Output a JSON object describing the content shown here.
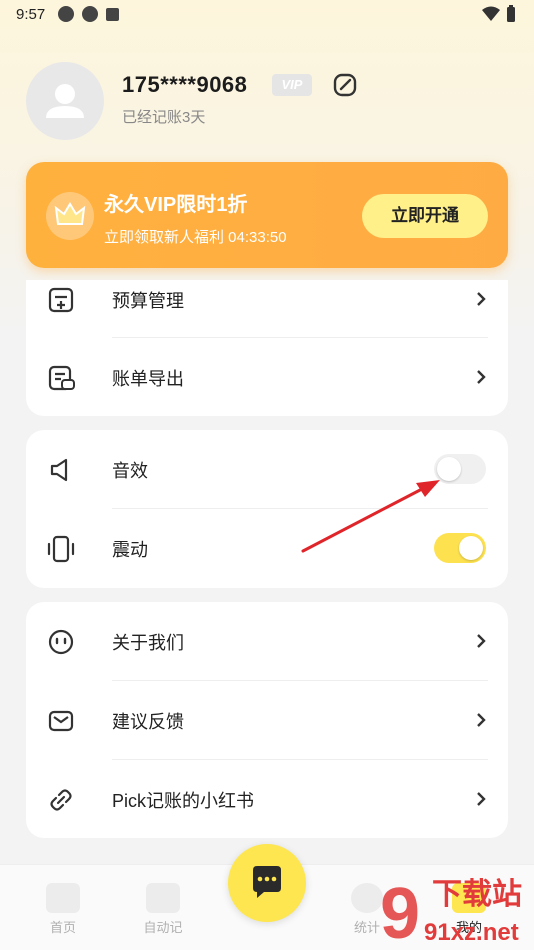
{
  "status_bar": {
    "time": "9:57"
  },
  "profile": {
    "username": "175****9068",
    "vip_badge": "VIP",
    "days": "已经记账3天"
  },
  "vip_banner": {
    "title": "永久VIP限时1折",
    "subtitle": "立即领取新人福利 04:33:50",
    "button": "立即开通"
  },
  "card1": {
    "items": [
      {
        "label": "预算管理"
      },
      {
        "label": "账单导出"
      }
    ]
  },
  "card2": {
    "items": [
      {
        "label": "音效",
        "toggle": false
      },
      {
        "label": "震动",
        "toggle": true
      }
    ]
  },
  "card3": {
    "items": [
      {
        "label": "关于我们"
      },
      {
        "label": "建议反馈"
      },
      {
        "label": "Pick记账的小红书"
      }
    ]
  },
  "tabbar": {
    "tabs": [
      {
        "label": "首页"
      },
      {
        "label": "自动记"
      },
      {
        "label": "统计"
      },
      {
        "label": "我的"
      }
    ]
  },
  "watermark": {
    "text1": "下载站",
    "text2": "91xz.net"
  },
  "colors": {
    "accent_yellow": "#fde14f",
    "banner_orange": "#ffae40",
    "arrow_red": "#e0252a"
  }
}
